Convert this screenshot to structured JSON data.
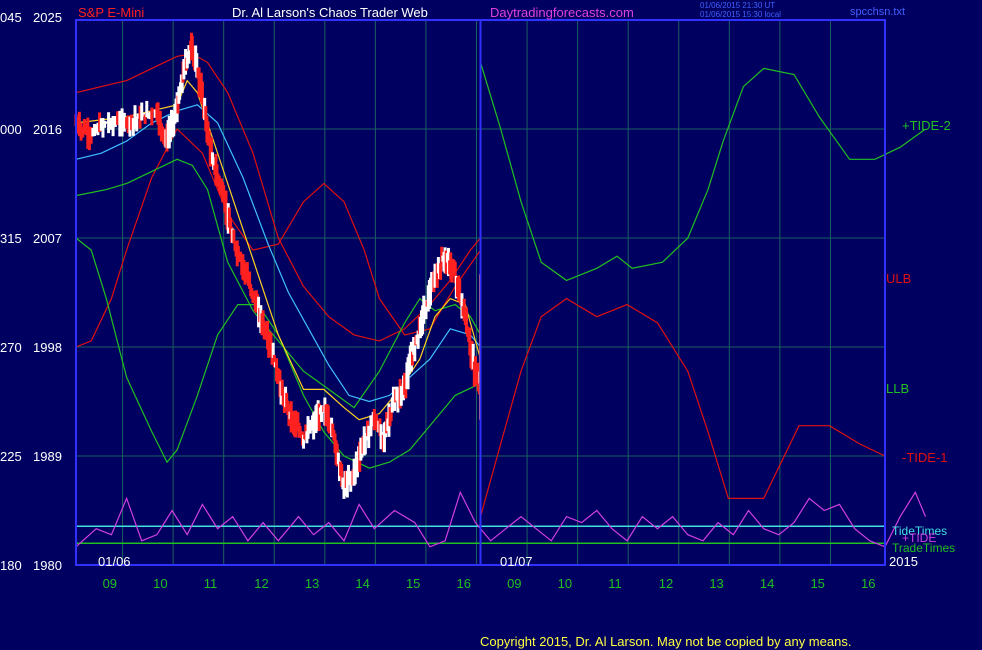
{
  "header": {
    "instrument": "S&P E-Mini",
    "title": "Dr. Al Larson's Chaos Trader Web",
    "site": "Daytradingforecasts.com",
    "stamp1": "01/06/2015 21:30 UT",
    "stamp2": "01/06/2015 15:30 local",
    "file": "spcchsn.txt"
  },
  "footer": {
    "copyright": "Copyright 2015, Dr. Al Larson. May not be copied by any means."
  },
  "colors": {
    "background": "#000060",
    "frame": "#3030ff",
    "grid": "#1a6060",
    "tick_text": "#20c020",
    "price_text": "#ffffff",
    "up_bar": "#ffffff",
    "down_bar": "#ff2020",
    "red_band": "#e01010",
    "green_band": "#20c020",
    "cyan_ma": "#40c0ff",
    "yellow_ma": "#ffd020",
    "tide_osc": "#d040e0",
    "tide_times": "#40e0e0",
    "trade_times": "#20c020"
  },
  "chart_data": {
    "type": "line",
    "title": "S&P E-Mini",
    "y_ticks": [
      {
        "left": "045",
        "price": "2025",
        "value": 2025
      },
      {
        "left": "000",
        "price": "2016",
        "value": 2016
      },
      {
        "left": "315",
        "price": "2007",
        "value": 2007
      },
      {
        "left": "270",
        "price": "1998",
        "value": 1998
      },
      {
        "left": "225",
        "price": "1989",
        "value": 1989
      },
      {
        "left": "180",
        "price": "1980",
        "value": 1980
      }
    ],
    "ylim": [
      1980,
      2025
    ],
    "x_ticks": [
      "09",
      "10",
      "11",
      "12",
      "13",
      "14",
      "15",
      "16",
      "09",
      "10",
      "11",
      "12",
      "13",
      "14",
      "15",
      "16"
    ],
    "date_labels": [
      "01/06",
      "01/07",
      "2015"
    ],
    "right_labels": {
      "tide2": "+TIDE-2",
      "ulb": "ULB",
      "llb": "LLB",
      "tide1": "-TIDE-1",
      "tide_times": "TideTimes",
      "tide": "+TIDE",
      "trade_times": "TradeTimes"
    },
    "x_range": [
      8.0,
      16.1
    ],
    "now_hour": 16.0,
    "series": [
      {
        "key": "upper_band",
        "color": "red",
        "points": [
          [
            8,
            2019
          ],
          [
            8.5,
            2019.5
          ],
          [
            9,
            2020
          ],
          [
            9.5,
            2021
          ],
          [
            10,
            2022
          ],
          [
            10.3,
            2022.2
          ],
          [
            10.6,
            2021.5
          ],
          [
            11,
            2019
          ],
          [
            11.5,
            2014
          ],
          [
            12,
            2007
          ],
          [
            12.5,
            2003
          ],
          [
            13,
            2000.5
          ],
          [
            13.5,
            1999
          ],
          [
            14,
            1998.5
          ],
          [
            14.5,
            1999.5
          ],
          [
            15,
            2001.5
          ],
          [
            15.4,
            2003.5
          ],
          [
            15.8,
            2006
          ],
          [
            16,
            2007
          ]
        ]
      },
      {
        "key": "red_mid",
        "color": "red",
        "points": [
          [
            8,
            1998
          ],
          [
            8.3,
            1998.5
          ],
          [
            8.7,
            2002
          ],
          [
            9,
            2006
          ],
          [
            9.5,
            2012
          ],
          [
            10,
            2016
          ],
          [
            10.5,
            2014
          ],
          [
            11,
            2009
          ],
          [
            11.5,
            2006
          ],
          [
            12,
            2006.5
          ],
          [
            12.5,
            2010
          ],
          [
            12.9,
            2011.5
          ],
          [
            13.3,
            2010
          ],
          [
            13.7,
            2006
          ],
          [
            14,
            2002
          ],
          [
            14.5,
            1999
          ],
          [
            15,
            1999.5
          ],
          [
            15.5,
            2003
          ],
          [
            16,
            2006
          ]
        ]
      },
      {
        "key": "forecast_red",
        "color": "red",
        "points": [
          [
            16,
            1984
          ],
          [
            16.4,
            1990
          ],
          [
            16.8,
            1996
          ],
          [
            17.2,
            2000.5
          ],
          [
            17.7,
            2002
          ],
          [
            18.3,
            2000.5
          ],
          [
            18.9,
            2001.5
          ],
          [
            19.5,
            2000
          ],
          [
            20.1,
            1996
          ],
          [
            20.5,
            1991
          ],
          [
            20.9,
            1985.5
          ],
          [
            21.6,
            1985.5
          ],
          [
            22.3,
            1991.5
          ],
          [
            22.9,
            1991.5
          ],
          [
            23.5,
            1990
          ],
          [
            24,
            1989
          ]
        ]
      },
      {
        "key": "green_upper",
        "color": "green",
        "points": [
          [
            8,
            2010.5
          ],
          [
            8.6,
            2011
          ],
          [
            9,
            2011.5
          ],
          [
            9.5,
            2012.5
          ],
          [
            10,
            2013.5
          ],
          [
            10.3,
            2013
          ],
          [
            10.6,
            2011
          ],
          [
            11,
            2005
          ],
          [
            11.5,
            2001
          ],
          [
            12,
            1998.5
          ],
          [
            12.5,
            1996
          ],
          [
            13,
            1994.5
          ],
          [
            13.5,
            1993
          ],
          [
            14,
            1996
          ],
          [
            14.5,
            2000
          ],
          [
            14.8,
            2002
          ],
          [
            15.1,
            2001
          ],
          [
            15.5,
            2001.5
          ],
          [
            15.8,
            2000.5
          ],
          [
            16,
            1999
          ]
        ]
      },
      {
        "key": "green_lower",
        "color": "green",
        "points": [
          [
            8,
            2007
          ],
          [
            8.3,
            2006
          ],
          [
            8.6,
            2002
          ],
          [
            9,
            1995.5
          ],
          [
            9.5,
            1991
          ],
          [
            9.8,
            1988.5
          ],
          [
            10,
            1989.5
          ],
          [
            10.4,
            1994
          ],
          [
            10.8,
            1999
          ],
          [
            11.2,
            2001.5
          ],
          [
            11.6,
            2001.5
          ],
          [
            12,
            1999
          ],
          [
            12.5,
            1994
          ],
          [
            12.9,
            1991
          ],
          [
            13.3,
            1989
          ],
          [
            13.8,
            1988
          ],
          [
            14.2,
            1988.5
          ],
          [
            14.6,
            1989.5
          ],
          [
            15,
            1991.5
          ],
          [
            15.5,
            1994
          ],
          [
            16,
            1995
          ]
        ]
      },
      {
        "key": "forecast_green",
        "color": "green",
        "points": [
          [
            16,
            2021.5
          ],
          [
            16.4,
            2016
          ],
          [
            16.8,
            2010
          ],
          [
            17.2,
            2005
          ],
          [
            17.7,
            2003.5
          ],
          [
            18.3,
            2004.5
          ],
          [
            18.7,
            2005.5
          ],
          [
            19,
            2004.5
          ],
          [
            19.6,
            2005
          ],
          [
            20.1,
            2007
          ],
          [
            20.5,
            2011
          ],
          [
            20.8,
            2015
          ],
          [
            21.2,
            2019.5
          ],
          [
            21.6,
            2021
          ],
          [
            22.2,
            2020.5
          ],
          [
            22.7,
            2017
          ],
          [
            23.3,
            2013.5
          ],
          [
            23.8,
            2013.5
          ],
          [
            24.3,
            2014.5
          ],
          [
            24.8,
            2016
          ]
        ]
      },
      {
        "key": "cyan_ma",
        "color": "cyan",
        "points": [
          [
            8,
            2013.5
          ],
          [
            8.5,
            2014
          ],
          [
            9,
            2015
          ],
          [
            9.5,
            2016.5
          ],
          [
            10,
            2017.5
          ],
          [
            10.4,
            2018
          ],
          [
            10.8,
            2016.5
          ],
          [
            11.3,
            2012
          ],
          [
            11.8,
            2006.5
          ],
          [
            12.2,
            2002.5
          ],
          [
            12.6,
            1999.5
          ],
          [
            13,
            1996.5
          ],
          [
            13.4,
            1994
          ],
          [
            13.8,
            1993.5
          ],
          [
            14.2,
            1994
          ],
          [
            14.6,
            1995.5
          ],
          [
            15,
            1997
          ],
          [
            15.4,
            1999.5
          ],
          [
            15.8,
            1999
          ],
          [
            16,
            1998
          ]
        ]
      },
      {
        "key": "yellow_ma",
        "color": "yellow",
        "points": [
          [
            8,
            2016.5
          ],
          [
            9,
            2017
          ],
          [
            9.5,
            2017.5
          ],
          [
            10,
            2018
          ],
          [
            10.2,
            2020
          ],
          [
            10.4,
            2019
          ],
          [
            10.8,
            2014
          ],
          [
            11.2,
            2009
          ],
          [
            11.6,
            2004
          ],
          [
            12,
            1999
          ],
          [
            12.5,
            1994.5
          ],
          [
            12.9,
            1994.5
          ],
          [
            13.3,
            1993
          ],
          [
            13.6,
            1992
          ],
          [
            14,
            1992.5
          ],
          [
            14.4,
            1994.5
          ],
          [
            14.8,
            1997
          ],
          [
            15.1,
            2000.5
          ],
          [
            15.4,
            2002
          ],
          [
            15.7,
            2001.5
          ],
          [
            16,
            1997
          ]
        ]
      },
      {
        "key": "price",
        "color": "price",
        "points": [
          [
            8,
            2016.5
          ],
          [
            8.3,
            2015.5
          ],
          [
            8.6,
            2016.5
          ],
          [
            9,
            2016.5
          ],
          [
            9.3,
            2017
          ],
          [
            9.6,
            2017.5
          ],
          [
            9.8,
            2015
          ],
          [
            10,
            2017.5
          ],
          [
            10.15,
            2021
          ],
          [
            10.3,
            2023
          ],
          [
            10.5,
            2019
          ],
          [
            10.7,
            2013.5
          ],
          [
            10.9,
            2011
          ],
          [
            11.1,
            2007
          ],
          [
            11.3,
            2005
          ],
          [
            11.5,
            2002.5
          ],
          [
            11.7,
            2000
          ],
          [
            11.9,
            1997.5
          ],
          [
            12.1,
            1994
          ],
          [
            12.3,
            1992
          ],
          [
            12.5,
            1990.5
          ],
          [
            12.7,
            1991.5
          ],
          [
            12.9,
            1993
          ],
          [
            13.1,
            1991
          ],
          [
            13.3,
            1986.5
          ],
          [
            13.5,
            1987.5
          ],
          [
            13.7,
            1990
          ],
          [
            13.9,
            1992
          ],
          [
            14.1,
            1990.5
          ],
          [
            14.3,
            1993.5
          ],
          [
            14.5,
            1994.5
          ],
          [
            14.7,
            1998
          ],
          [
            14.9,
            2001
          ],
          [
            15.1,
            2003.5
          ],
          [
            15.3,
            2005.5
          ],
          [
            15.5,
            2004
          ],
          [
            15.7,
            2000.5
          ],
          [
            15.9,
            1996
          ],
          [
            16,
            1995
          ]
        ]
      },
      {
        "key": "tide_osc",
        "color": "tide",
        "points": [
          [
            8,
            1981.5
          ],
          [
            8.4,
            1983
          ],
          [
            8.7,
            1982.5
          ],
          [
            9,
            1985.5
          ],
          [
            9.3,
            1982
          ],
          [
            9.6,
            1982.5
          ],
          [
            9.9,
            1984.5
          ],
          [
            10.2,
            1982.5
          ],
          [
            10.5,
            1985
          ],
          [
            10.8,
            1983
          ],
          [
            11.1,
            1984
          ],
          [
            11.4,
            1982
          ],
          [
            11.7,
            1983.5
          ],
          [
            12,
            1982
          ],
          [
            12.4,
            1984
          ],
          [
            12.7,
            1982.5
          ],
          [
            13,
            1983.5
          ],
          [
            13.3,
            1982
          ],
          [
            13.6,
            1985
          ],
          [
            13.9,
            1983
          ],
          [
            14.3,
            1984.5
          ],
          [
            14.7,
            1983.5
          ],
          [
            15,
            1981.5
          ],
          [
            15.3,
            1982
          ],
          [
            15.6,
            1986
          ],
          [
            15.9,
            1983.5
          ],
          [
            16.2,
            1982
          ],
          [
            16.5,
            1983
          ],
          [
            16.8,
            1984
          ],
          [
            17.1,
            1983
          ],
          [
            17.4,
            1982
          ],
          [
            17.7,
            1984
          ],
          [
            18,
            1983.5
          ],
          [
            18.3,
            1984.5
          ],
          [
            18.6,
            1983
          ],
          [
            18.9,
            1982
          ],
          [
            19.2,
            1984
          ],
          [
            19.5,
            1983
          ],
          [
            19.8,
            1984
          ],
          [
            20.1,
            1982.5
          ],
          [
            20.4,
            1982
          ],
          [
            20.7,
            1983.5
          ],
          [
            21,
            1982.5
          ],
          [
            21.3,
            1984.5
          ],
          [
            21.6,
            1983
          ],
          [
            21.9,
            1982.5
          ],
          [
            22.2,
            1983.5
          ],
          [
            22.5,
            1985.5
          ],
          [
            22.8,
            1984.5
          ],
          [
            23.1,
            1985
          ],
          [
            23.4,
            1983
          ],
          [
            23.7,
            1982
          ],
          [
            24,
            1981.5
          ],
          [
            24.3,
            1984
          ],
          [
            24.6,
            1986
          ],
          [
            24.8,
            1984
          ]
        ]
      }
    ],
    "tide_times_level": 1983.2,
    "trade_times_level": 1981.8
  }
}
